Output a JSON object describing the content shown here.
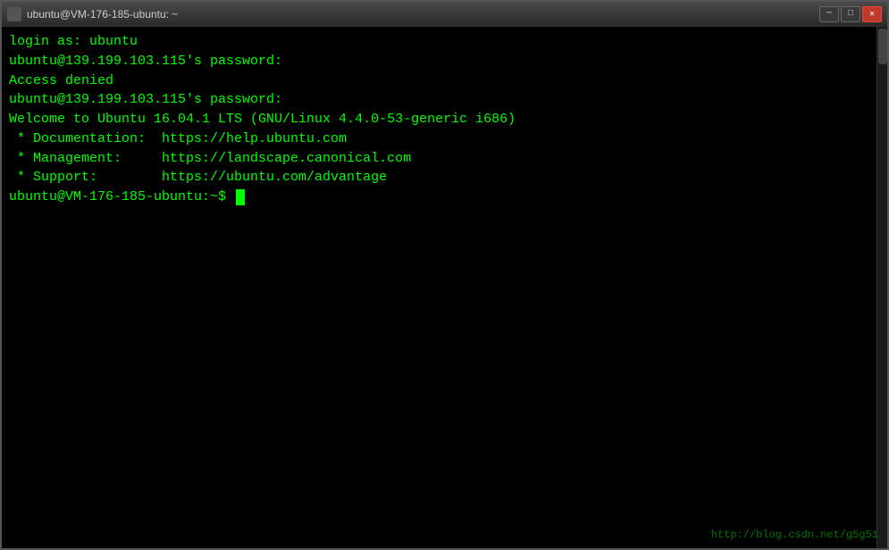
{
  "window": {
    "title": "ubuntu@VM-176-185-ubuntu: ~",
    "minimize_label": "─",
    "maximize_label": "□",
    "close_label": "✕"
  },
  "terminal": {
    "lines": [
      "login as: ubuntu",
      "ubuntu@139.199.103.115's password:",
      "Access denied",
      "ubuntu@139.199.103.115's password:",
      "Welcome to Ubuntu 16.04.1 LTS (GNU/Linux 4.4.0-53-generic i686)",
      "",
      " * Documentation:  https://help.ubuntu.com",
      " * Management:     https://landscape.canonical.com",
      " * Support:        https://ubuntu.com/advantage",
      ""
    ],
    "prompt": "ubuntu@VM-176-185-ubuntu:~$ "
  },
  "watermark": {
    "text": "http://blog.csdn.net/g5g51"
  }
}
